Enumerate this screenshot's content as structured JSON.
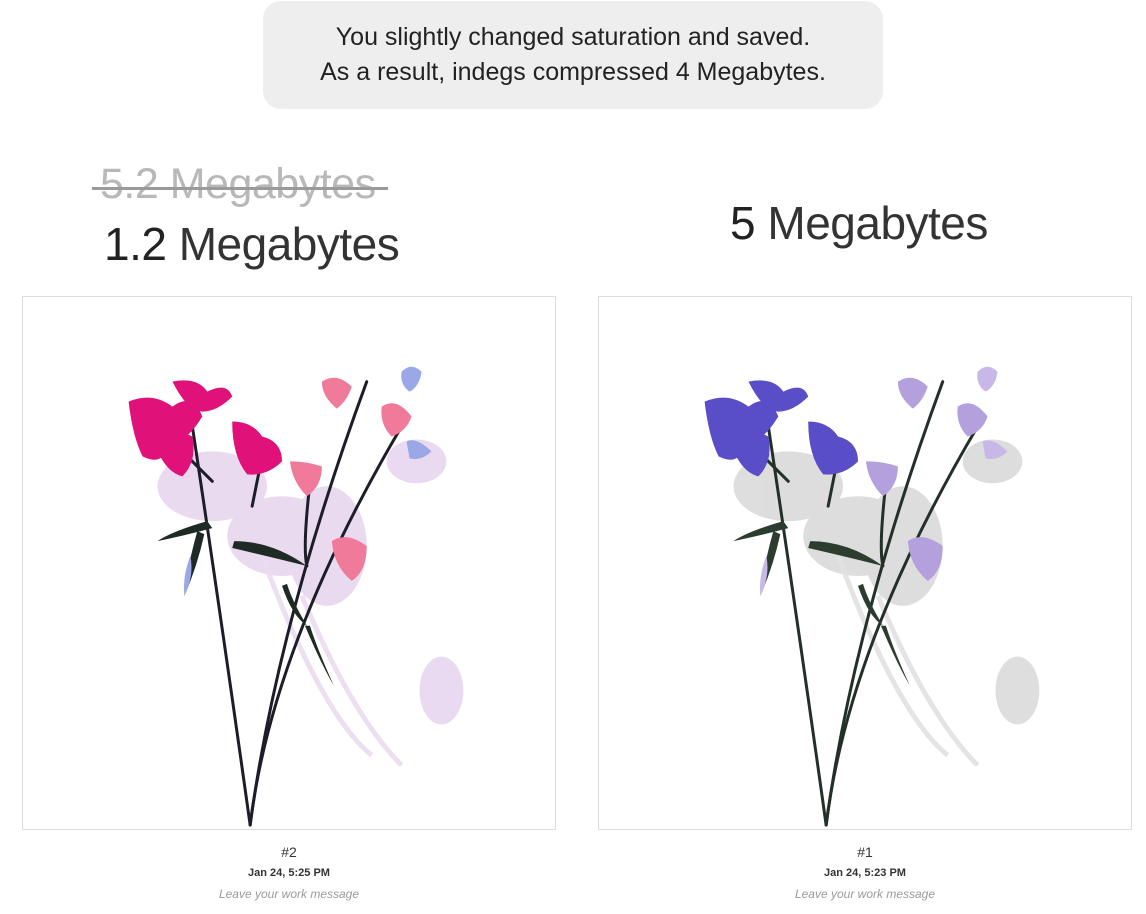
{
  "banner": {
    "line1": "You slightly changed saturation and saved.",
    "line2": "As a result, indegs compressed 4 Megabytes."
  },
  "left": {
    "old_size_number": "5.2",
    "old_size_unit": "Megabytes",
    "new_size_number": "1.2",
    "new_size_unit": "Megabytes",
    "image_icon": "flower-photo-saturated",
    "version": "#2",
    "date": "Jan 24, 5:25 PM",
    "message_placeholder": "Leave your work message",
    "flower_colors": {
      "large": "#e0127a",
      "small": "#f07a9a",
      "bud": "#9aa8e8",
      "shadow": "#e6d4ee"
    }
  },
  "right": {
    "size_number": "5",
    "size_unit": "Megabytes",
    "image_icon": "flower-photo-original",
    "version": "#1",
    "date": "Jan 24, 5:23 PM",
    "message_placeholder": "Leave your work message",
    "flower_colors": {
      "large": "#5a4ec8",
      "small": "#b4a0dc",
      "bud": "#c8b8e8",
      "shadow": "#d8d8d8"
    }
  }
}
